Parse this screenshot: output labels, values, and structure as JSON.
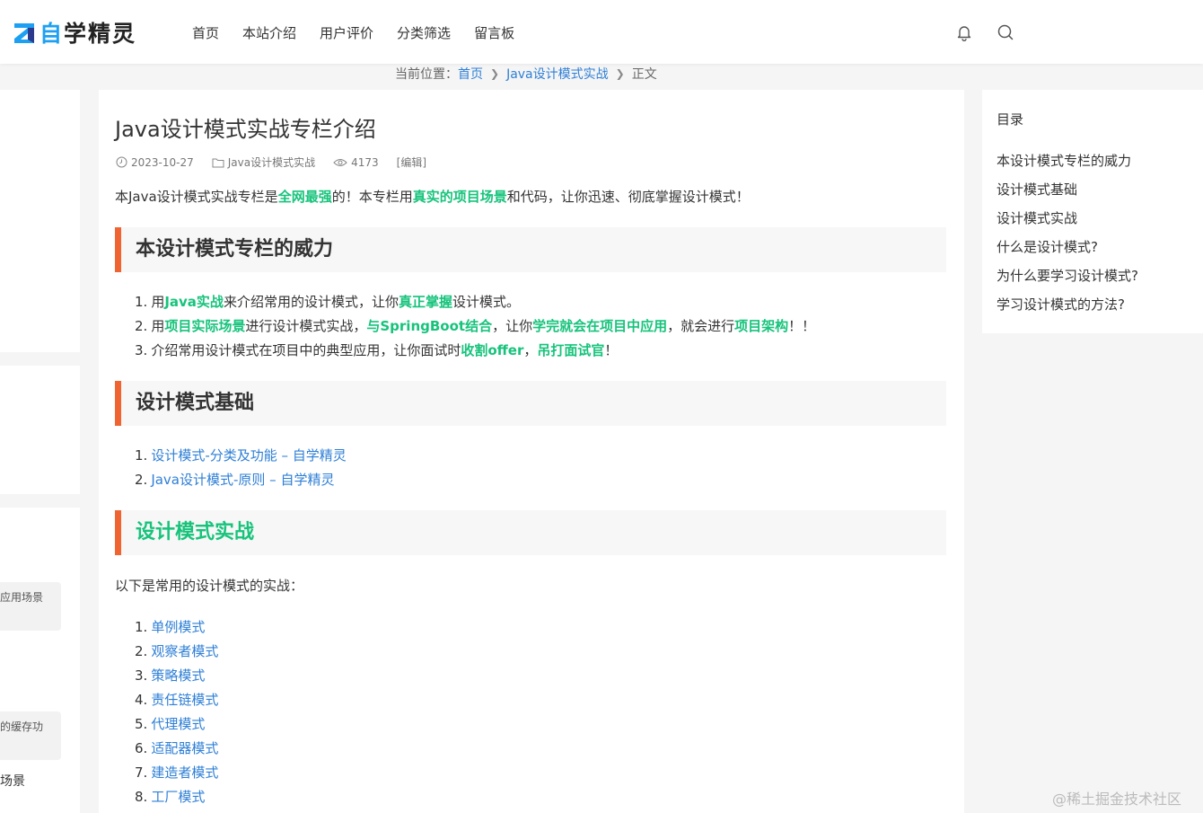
{
  "header": {
    "logo_first": "自",
    "logo_rest": "学精灵",
    "nav": [
      "首页",
      "本站介绍",
      "用户评价",
      "分类筛选",
      "留言板"
    ],
    "icons": [
      "bell-icon",
      "search-icon"
    ]
  },
  "breadcrumb": {
    "prefix": "当前位置：",
    "home": "首页",
    "category": "Java设计模式实战",
    "current": "正文"
  },
  "left": {
    "snippet1": "应用场景",
    "snippet2": "的缓存功",
    "text3": "场景"
  },
  "article": {
    "title": "Java设计模式实战专栏介绍",
    "date": "2023-10-27",
    "category": "Java设计模式实战",
    "views": "4173",
    "edit": "[编辑]",
    "intro": {
      "t1": "本Java设计模式实战专栏是",
      "h1": "全网最强",
      "t2": "的！本专栏用",
      "h2": "真实的项目场景",
      "t3": "和代码，让你迅速、彻底掌握设计模式！"
    },
    "section1": {
      "heading": "本设计模式专栏的威力",
      "item1": {
        "num": "1.",
        "t1": "用",
        "h1": "Java实战",
        "t2": "来介绍常用的设计模式，让你",
        "h2": "真正掌握",
        "t3": "设计模式。"
      },
      "item2": {
        "num": "2.",
        "t1": "用",
        "h1": "项目实际场景",
        "t2": "进行设计模式实战，",
        "h2": "与SpringBoot结合",
        "t3": "，让你",
        "h3": "学完就会在项目中应用",
        "t4": "，就会进行",
        "h4": "项目架构",
        "t5": "！！"
      },
      "item3": {
        "num": "3.",
        "t1": "介绍常用设计模式在项目中的典型应用，让你面试时",
        "h1": "收割offer",
        "t2": "，",
        "h2": "吊打面试官",
        "t3": "！"
      }
    },
    "section2": {
      "heading": "设计模式基础",
      "links": [
        {
          "num": "1.",
          "text": "设计模式-分类及功能 – 自学精灵"
        },
        {
          "num": "2.",
          "text": "Java设计模式-原则 – 自学精灵"
        }
      ]
    },
    "section3": {
      "heading": "设计模式实战",
      "para": "以下是常用的设计模式的实战：",
      "links": [
        {
          "num": "1.",
          "text": "单例模式"
        },
        {
          "num": "2.",
          "text": "观察者模式"
        },
        {
          "num": "3.",
          "text": "策略模式"
        },
        {
          "num": "4.",
          "text": "责任链模式"
        },
        {
          "num": "5.",
          "text": "代理模式"
        },
        {
          "num": "6.",
          "text": "适配器模式"
        },
        {
          "num": "7.",
          "text": "建造者模式"
        },
        {
          "num": "8.",
          "text": "工厂模式"
        }
      ]
    }
  },
  "toc": {
    "title": "目录",
    "items": [
      "本设计模式专栏的威力",
      "设计模式基础",
      "设计模式实战",
      "什么是设计模式?",
      "为什么要学习设计模式?",
      "学习设计模式的方法?"
    ]
  },
  "watermark": "@稀土掘金技术社区",
  "colors": {
    "accent_green": "#17c37b",
    "link_blue": "#2e7fd6",
    "heading_bar": "#f06431"
  }
}
